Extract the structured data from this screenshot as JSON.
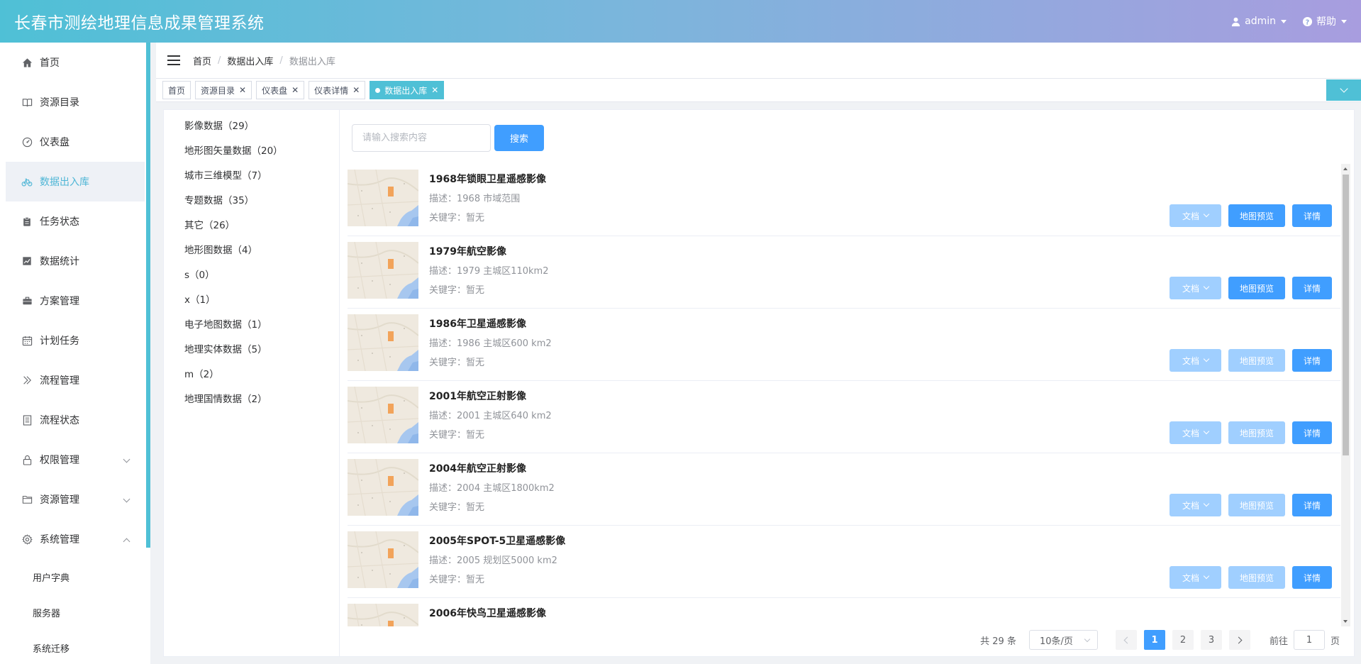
{
  "header": {
    "title": "长春市测绘地理信息成果管理系统",
    "user": "admin",
    "help": "帮助"
  },
  "sidebar": {
    "items": [
      {
        "label": "首页",
        "icon": "home-icon"
      },
      {
        "label": "资源目录",
        "icon": "book-icon"
      },
      {
        "label": "仪表盘",
        "icon": "gauge-icon"
      },
      {
        "label": "数据出入库",
        "icon": "bicycle-icon"
      },
      {
        "label": "任务状态",
        "icon": "clipboard-icon"
      },
      {
        "label": "数据统计",
        "icon": "chart-icon"
      },
      {
        "label": "方案管理",
        "icon": "briefcase-icon"
      },
      {
        "label": "计划任务",
        "icon": "calendar-icon"
      },
      {
        "label": "流程管理",
        "icon": "double-chevron-icon"
      },
      {
        "label": "流程状态",
        "icon": "document-icon"
      },
      {
        "label": "权限管理",
        "icon": "lock-icon"
      },
      {
        "label": "资源管理",
        "icon": "folder-icon"
      },
      {
        "label": "系统管理",
        "icon": "gear-icon"
      }
    ],
    "subitems": [
      "用户字典",
      "服务器",
      "系统迁移"
    ],
    "active_index": 3
  },
  "breadcrumb": [
    "首页",
    "数据出入库",
    "数据出入库"
  ],
  "tags": [
    "首页",
    "资源目录",
    "仪表盘",
    "仪表详情",
    "数据出入库"
  ],
  "categories": [
    "影像数据（29）",
    "地形图矢量数据（20）",
    "城市三维模型（7）",
    "专题数据（35）",
    "其它（26）",
    "地形图数据（4）",
    "s（0）",
    "x（1）",
    "电子地图数据（1）",
    "地理实体数据（5）",
    "m（2）",
    "地理国情数据（2）"
  ],
  "search": {
    "placeholder": "请输入搜索内容",
    "button": "搜索"
  },
  "buttons": {
    "doc": "文档",
    "map": "地图预览",
    "detail": "详情"
  },
  "results": [
    {
      "title": "1968年锁眼卫星遥感影像",
      "desc": "描述：1968 市域范围",
      "keywords": "关键字：暂无",
      "map_enabled": true
    },
    {
      "title": "1979年航空影像",
      "desc": "描述：1979 主城区110km2",
      "keywords": "关键字：暂无",
      "map_enabled": true
    },
    {
      "title": "1986年卫星遥感影像",
      "desc": "描述：1986 主城区600 km2",
      "keywords": "关键字：暂无",
      "map_enabled": false
    },
    {
      "title": "2001年航空正射影像",
      "desc": "描述：2001 主城区640 km2",
      "keywords": "关键字：暂无",
      "map_enabled": false
    },
    {
      "title": "2004年航空正射影像",
      "desc": "描述：2004 主城区1800km2",
      "keywords": "关键字：暂无",
      "map_enabled": false
    },
    {
      "title": "2005年SPOT-5卫星遥感影像",
      "desc": "描述：2005 规划区5000 km2",
      "keywords": "关键字：暂无",
      "map_enabled": false
    },
    {
      "title": "2006年快鸟卫星遥感影像",
      "desc": "",
      "keywords": "",
      "map_enabled": false
    }
  ],
  "pagination": {
    "total": "共 29 条",
    "page_size": "10条/页",
    "pages": [
      "1",
      "2",
      "3"
    ],
    "current": "1",
    "goto_label": "前往",
    "goto_value": "1",
    "goto_suffix": "页"
  },
  "colors": {
    "header_start": "#4fc0d6",
    "header_end": "#a89ddf",
    "primary": "#409eff",
    "primary_light": "#a0cfff",
    "accent": "#4fc0d6"
  }
}
